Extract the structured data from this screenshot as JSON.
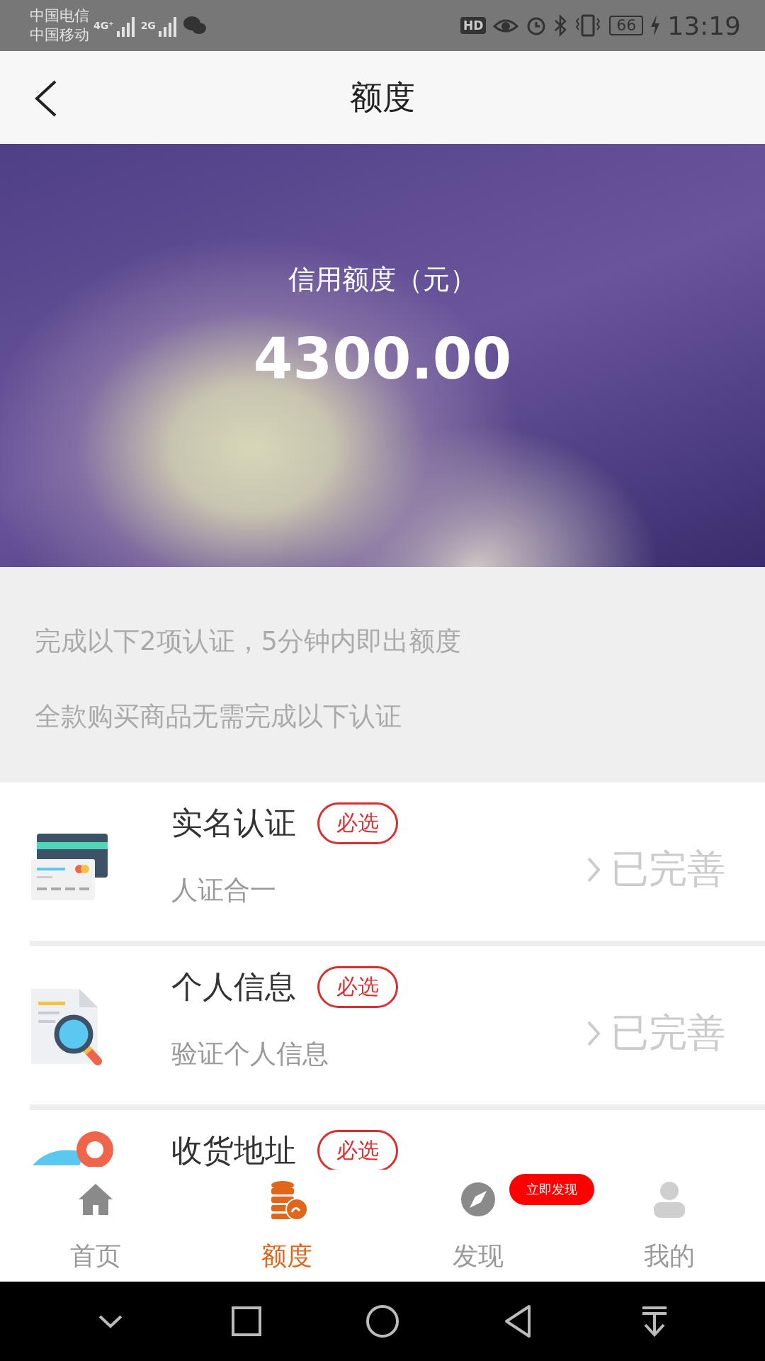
{
  "status_bar": {
    "carriers": [
      "中国电信",
      "中国移动"
    ],
    "network_1": "4G⁺",
    "network_2": "2G",
    "hd": "HD",
    "battery": "66",
    "time": "13:19"
  },
  "header": {
    "title": "额度"
  },
  "banner": {
    "label": "信用额度（元）",
    "amount": "4300.00"
  },
  "notes": [
    "完成以下2项认证，5分钟内即出额度",
    "全款购买商品无需完成以下认证"
  ],
  "items": [
    {
      "kind": "card",
      "title": "实名认证",
      "tag": "必选",
      "subtitle": "人证合一",
      "status": "已完善"
    },
    {
      "kind": "search",
      "title": "个人信息",
      "tag": "必选",
      "subtitle": "验证个人信息",
      "status": "已完善"
    },
    {
      "kind": "pin",
      "title": "收货地址",
      "tag": "必选"
    }
  ],
  "nav": [
    {
      "kind": "home",
      "label": "首页",
      "selected": false
    },
    {
      "kind": "coins",
      "label": "额度",
      "selected": true
    },
    {
      "kind": "compass",
      "label": "发现",
      "selected": false,
      "badge": "立即发现"
    },
    {
      "kind": "person",
      "label": "我的",
      "selected": false
    }
  ]
}
